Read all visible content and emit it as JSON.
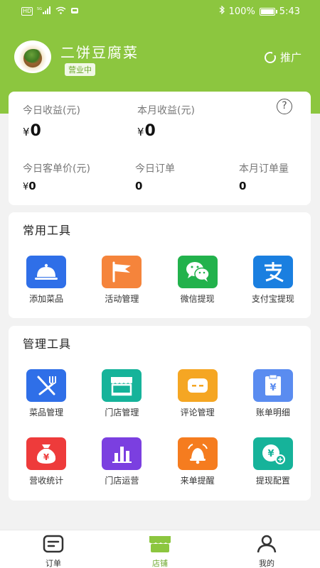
{
  "status_bar": {
    "signal_text": "5G",
    "battery_pct": "100%",
    "time": "5:43",
    "hd_label": "HD"
  },
  "shop": {
    "name": "二饼豆腐菜",
    "status": "营业中",
    "promote_label": "推广"
  },
  "stats": {
    "today_income_label": "今日收益(元)",
    "today_income_value": "0",
    "month_income_label": "本月收益(元)",
    "month_income_value": "0",
    "currency": "¥",
    "avg_price_label": "今日客单价(元)",
    "avg_price_value": "0",
    "today_orders_label": "今日订单",
    "today_orders_value": "0",
    "month_orders_label": "本月订单量",
    "month_orders_value": "0",
    "help_symbol": "?"
  },
  "common_tools": {
    "title": "常用工具",
    "items": [
      {
        "label": "添加菜品",
        "icon": "cloche-icon",
        "color": "#2f6fe8"
      },
      {
        "label": "活动管理",
        "icon": "flag-icon",
        "color": "#f5843b"
      },
      {
        "label": "微信提现",
        "icon": "wechat-icon",
        "color": "#22b24c"
      },
      {
        "label": "支付宝提现",
        "icon": "alipay-icon",
        "color": "#1a7fe0"
      }
    ]
  },
  "manage_tools": {
    "title": "管理工具",
    "items": [
      {
        "label": "菜品管理",
        "icon": "cutlery-icon",
        "color": "#2f6fe8"
      },
      {
        "label": "门店管理",
        "icon": "storefront-icon",
        "color": "#16b39a"
      },
      {
        "label": "评论管理",
        "icon": "comment-icon",
        "color": "#f5a623"
      },
      {
        "label": "账单明细",
        "icon": "bill-icon",
        "color": "#5a8cf0"
      },
      {
        "label": "营收统计",
        "icon": "money-bag-icon",
        "color": "#ee3b3b"
      },
      {
        "label": "门店运营",
        "icon": "bar-chart-icon",
        "color": "#7b3fe0"
      },
      {
        "label": "来单提醒",
        "icon": "bell-icon",
        "color": "#f57c1f"
      },
      {
        "label": "提现配置",
        "icon": "withdraw-icon",
        "color": "#16b39a"
      }
    ]
  },
  "tabbar": {
    "items": [
      {
        "label": "订单",
        "icon": "order-icon",
        "active": false
      },
      {
        "label": "店铺",
        "icon": "shop-icon",
        "active": true
      },
      {
        "label": "我的",
        "icon": "user-icon",
        "active": false
      }
    ],
    "active_color": "#6ea92e"
  },
  "theme": {
    "header_green": "#8cc63f"
  }
}
